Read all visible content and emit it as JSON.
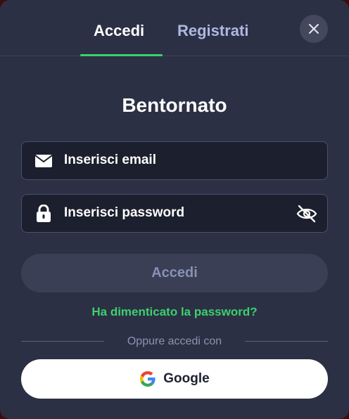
{
  "tabs": [
    {
      "label": "Accedi",
      "active": true
    },
    {
      "label": "Registrati",
      "active": false
    }
  ],
  "close": {
    "icon": "close-icon"
  },
  "title": "Bentornato",
  "email": {
    "placeholder": "Inserisci email",
    "value": "",
    "icon": "envelope-icon"
  },
  "password": {
    "placeholder": "Inserisci password",
    "value": "",
    "icon": "lock-icon",
    "toggle_icon": "eye-off-icon"
  },
  "submit_label": "Accedi",
  "forgot_label": "Ha dimenticato la password?",
  "divider_text": "Oppure accedi con",
  "google_label": "Google",
  "colors": {
    "background": "#2c3044",
    "accent": "#3bd16f",
    "input_bg": "#1c1f2d",
    "disabled_button": "#3a3f55"
  }
}
